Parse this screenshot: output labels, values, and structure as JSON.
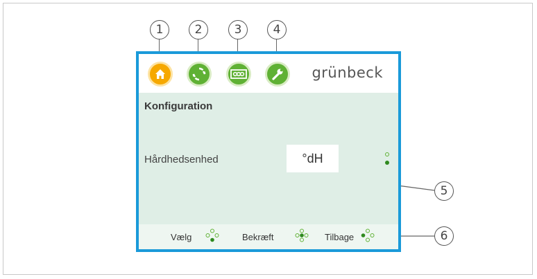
{
  "callouts": {
    "c1": "1",
    "c2": "2",
    "c3": "3",
    "c4": "4",
    "c5": "5",
    "c6": "6"
  },
  "header": {
    "brand": "grünbeck"
  },
  "nav": [
    {
      "icon": "home-icon",
      "color": "#f6a800"
    },
    {
      "icon": "refresh-cycle-icon",
      "color": "#5fb134"
    },
    {
      "icon": "counter-display-icon",
      "color": "#5fb134"
    },
    {
      "icon": "wrench-icon",
      "color": "#5fb134"
    }
  ],
  "screen": {
    "title": "Konfiguration",
    "setting_label": "Hårdhedsenhed",
    "setting_value": "°dH"
  },
  "footer": {
    "select_label": "Vælg",
    "confirm_label": "Bekræft",
    "back_label": "Tilbage"
  },
  "colors": {
    "frame": "#1a9ad9",
    "accent_green": "#5fb134",
    "home_orange": "#f6a800",
    "panel": "#dfeee6"
  }
}
